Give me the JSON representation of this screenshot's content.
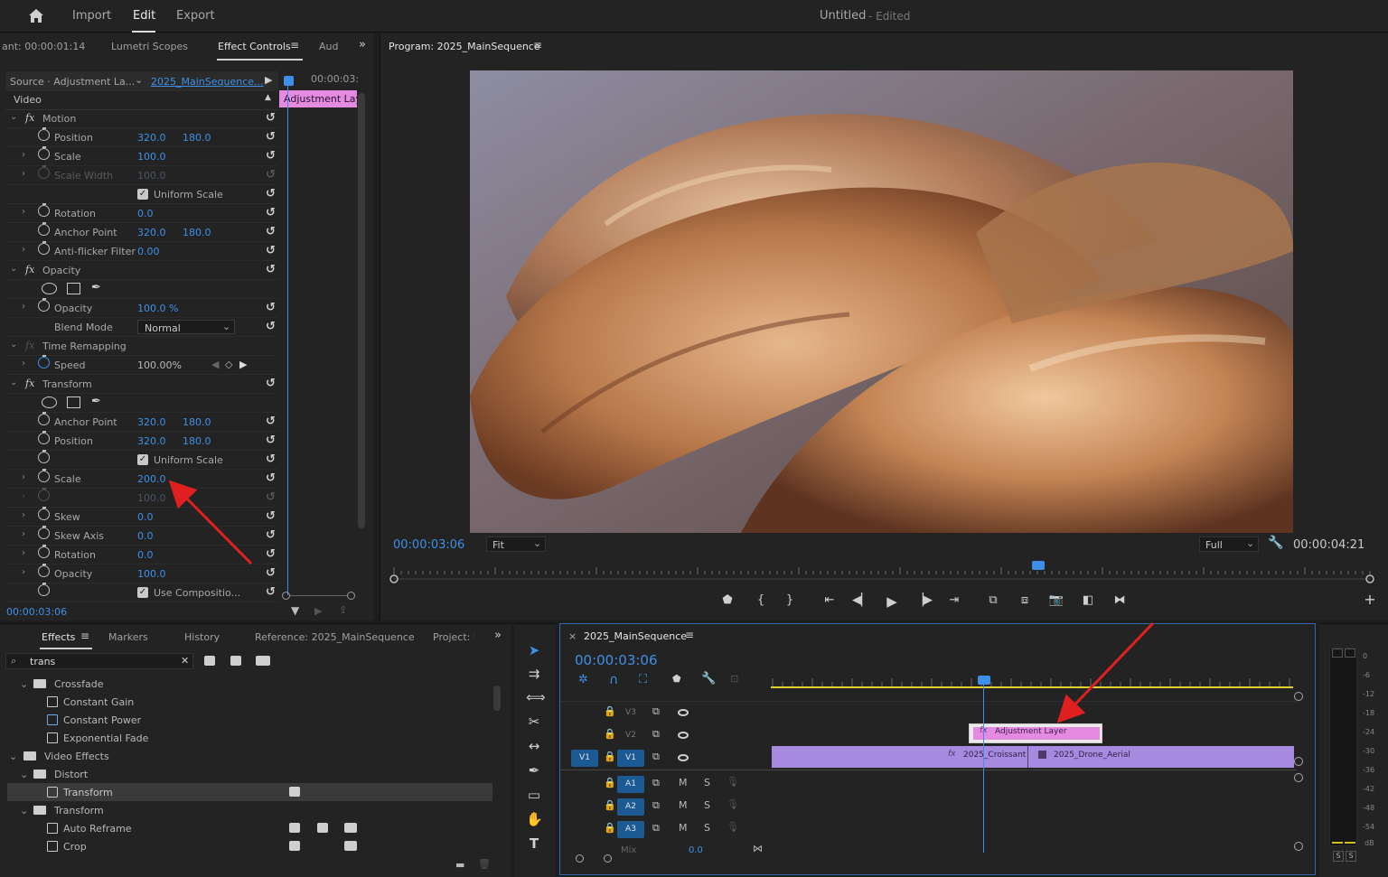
{
  "app": {
    "title": "Untitled",
    "status": "- Edited",
    "menu": [
      "Import",
      "Edit",
      "Export"
    ]
  },
  "left_tabs": {
    "timecode_fragment": "ant: 00:00:01:14",
    "tabs": [
      "Lumetri Scopes",
      "Effect Controls",
      "Aud"
    ]
  },
  "effect_controls": {
    "source": "Source · Adjustment La...",
    "sequence": "2025_MainSequence...",
    "header_time": "00:00:03:",
    "clip_label": "Adjustment Lay",
    "section": "Video",
    "footer_time": "00:00:03:06",
    "rows": [
      {
        "label": "Motion",
        "v1": "",
        "v2": ""
      },
      {
        "label": "Position",
        "v1": "320.0",
        "v2": "180.0"
      },
      {
        "label": "Scale",
        "v1": "100.0",
        "v2": ""
      },
      {
        "label": "Scale Width",
        "v1": "100.0",
        "v2": ""
      },
      {
        "label": "Uniform Scale",
        "v1": "",
        "v2": ""
      },
      {
        "label": "Rotation",
        "v1": "0.0",
        "v2": ""
      },
      {
        "label": "Anchor Point",
        "v1": "320.0",
        "v2": "180.0"
      },
      {
        "label": "Anti-flicker Filter",
        "v1": "0.00",
        "v2": ""
      },
      {
        "label": "Opacity",
        "v1": "",
        "v2": ""
      },
      {
        "label": "",
        "v1": "",
        "v2": ""
      },
      {
        "label": "Opacity",
        "v1": "100.0 %",
        "v2": ""
      },
      {
        "label": "Blend Mode",
        "v1": "Normal",
        "v2": ""
      },
      {
        "label": "Time Remapping",
        "v1": "",
        "v2": ""
      },
      {
        "label": "Speed",
        "v1": "100.00%",
        "v2": ""
      },
      {
        "label": "Transform",
        "v1": "",
        "v2": ""
      },
      {
        "label": "",
        "v1": "",
        "v2": ""
      },
      {
        "label": "Anchor Point",
        "v1": "320.0",
        "v2": "180.0"
      },
      {
        "label": "Position",
        "v1": "320.0",
        "v2": "180.0"
      },
      {
        "label": "Uniform Scale",
        "v1": "",
        "v2": ""
      },
      {
        "label": "Scale",
        "v1": "200.0",
        "v2": ""
      },
      {
        "label": "",
        "v1": "100.0",
        "v2": ""
      },
      {
        "label": "Skew",
        "v1": "0.0",
        "v2": ""
      },
      {
        "label": "Skew Axis",
        "v1": "0.0",
        "v2": ""
      },
      {
        "label": "Rotation",
        "v1": "0.0",
        "v2": ""
      },
      {
        "label": "Opacity",
        "v1": "100.0",
        "v2": ""
      },
      {
        "label": "Use Compositio...",
        "v1": "",
        "v2": ""
      }
    ]
  },
  "program": {
    "title": "Program: 2025_MainSequence",
    "timecode": "00:00:03:06",
    "fit": "Fit",
    "quality": "Full",
    "duration": "00:00:04:21",
    "playhead_fraction": 0.66
  },
  "effects_panel": {
    "tabs": [
      "Effects",
      "Markers",
      "History",
      "Reference: 2025_MainSequence",
      "Project: U"
    ],
    "search": "trans",
    "items": [
      {
        "label": "Crossfade"
      },
      {
        "label": "Constant Gain"
      },
      {
        "label": "Constant Power"
      },
      {
        "label": "Exponential Fade"
      },
      {
        "label": "Video Effects"
      },
      {
        "label": "Distort"
      },
      {
        "label": "Transform"
      },
      {
        "label": "Transform"
      },
      {
        "label": "Auto Reframe"
      },
      {
        "label": "Crop"
      }
    ]
  },
  "timeline": {
    "title": "2025_MainSequence",
    "timecode": "00:00:03:06",
    "tracks": {
      "v3": "V3",
      "v2": "V2",
      "v1": "V1",
      "v1_src": "V1",
      "a1": "A1",
      "a2": "A2",
      "a3": "A3",
      "m": "M",
      "s": "S",
      "mix": "Mix",
      "mix_val": "0.0"
    },
    "clips": {
      "adjustment": "Adjustment Layer",
      "croissant": "2025_Croissant",
      "drone": "2025_Drone_Aerial"
    }
  },
  "meter": {
    "labels": [
      "0",
      "-6",
      "-12",
      "-18",
      "-24",
      "-30",
      "-36",
      "-42",
      "-48",
      "-54",
      "dB"
    ],
    "s1": "S",
    "s2": "S"
  },
  "colors": {
    "blue": "#3f8fe8",
    "pink": "#e48ae0",
    "purple": "#a68ae0",
    "annotation": "#e02020"
  }
}
